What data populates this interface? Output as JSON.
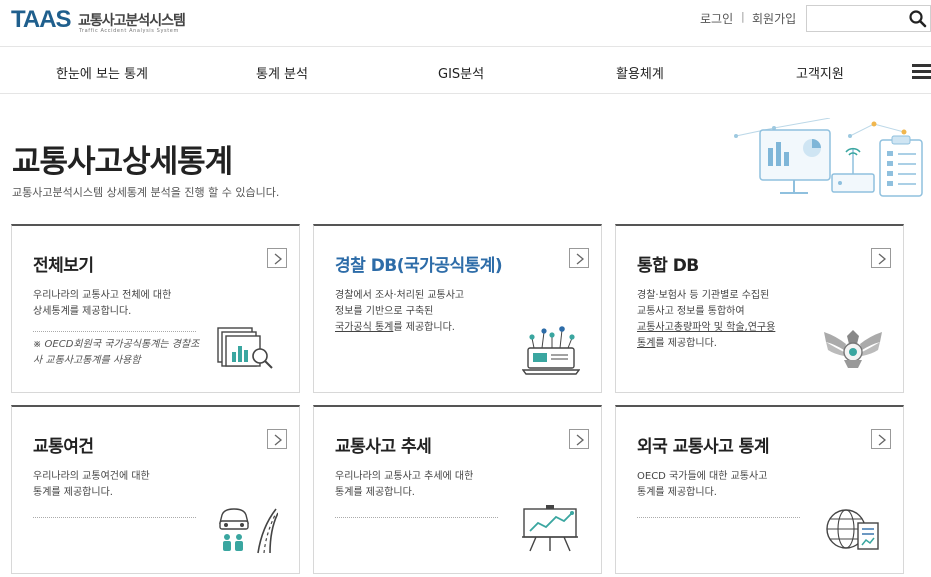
{
  "header": {
    "logo_text": "TAAS",
    "logo_system": "교통사고분석시스템",
    "logo_sub": "Traffic Accident Analysis System",
    "login": "로그인",
    "separator": "|",
    "signup": "회원가입",
    "search": {
      "value": "",
      "placeholder": ""
    }
  },
  "nav": {
    "items": [
      "한눈에 보는 통계",
      "통계 분석",
      "GIS분석",
      "활용체계",
      "고객지원"
    ]
  },
  "page": {
    "title": "교통사고상세통계",
    "description": "교통사고분석시스템 상세통계 분석을 진행 할 수 있습니다."
  },
  "cards": [
    {
      "title": "전체보기",
      "desc": [
        "우리나라의 교통사고 전체에 대한",
        "상세통계를 제공합니다."
      ],
      "note": "※ OECD회원국 국가공식통계는 경찰조사 교통사고통계를 사용함",
      "icon": "chart-documents-magnifier-icon"
    },
    {
      "title": "경찰 DB(국가공식통계)",
      "desc": [
        "경찰에서 조사·처리된 교통사고",
        "정보를 기반으로 구축된"
      ],
      "desc_underline": "국가공식 통계",
      "desc_tail": "를 제공합니다.",
      "icon": "laptop-network-icon"
    },
    {
      "title": "통합 DB",
      "desc": [
        "경찰·보험사 등 기관별로 수집된",
        "교통사고 정보를 통합하여"
      ],
      "desc_underline": "교통사고총량파악 및 학술,연구용",
      "desc_underline2": "통계",
      "desc_tail": "를 제공합니다.",
      "icon": "police-emblem-icon"
    },
    {
      "title": "교통여건",
      "desc": [
        "우리나라의 교통여건에 대한",
        "통계를 제공합니다."
      ],
      "icon": "car-road-people-icon"
    },
    {
      "title": "교통사고 추세",
      "desc": [
        "우리나라의 교통사고 추세에 대한",
        "통계를 제공합니다."
      ],
      "icon": "trend-board-icon"
    },
    {
      "title": "외국 교통사고 통계",
      "desc": [
        "OECD 국가들에 대한 교통사고",
        "통계를 제공합니다."
      ],
      "icon": "globe-report-icon"
    }
  ],
  "colors": {
    "logo": "#1f5f8d",
    "accent_blue": "#2d6ca8",
    "icon_teal": "#3aa6a0",
    "card_border_top": "#555555"
  }
}
